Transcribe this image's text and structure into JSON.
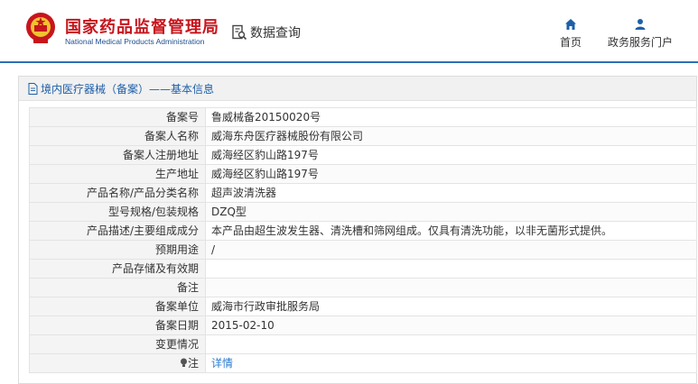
{
  "header": {
    "org_name_cn": "国家药品监督管理局",
    "org_name_en": "National Medical Products Administration",
    "query_label": "数据查询",
    "nav": [
      {
        "label": "首页",
        "icon": "home-icon"
      },
      {
        "label": "政务服务门户",
        "icon": "user-icon"
      }
    ]
  },
  "panel": {
    "title": "境内医疗器械（备案）——基本信息",
    "title_icon": "document-icon"
  },
  "rows": [
    {
      "key": "备案号",
      "value": "鲁威械备20150020号"
    },
    {
      "key": "备案人名称",
      "value": "威海东舟医疗器械股份有限公司"
    },
    {
      "key": "备案人注册地址",
      "value": "威海经区豹山路197号"
    },
    {
      "key": "生产地址",
      "value": "威海经区豹山路197号"
    },
    {
      "key": "产品名称/产品分类名称",
      "value": "超声波清洗器"
    },
    {
      "key": "型号规格/包装规格",
      "value": "DZQ型"
    },
    {
      "key": "产品描述/主要组成成分",
      "value": "本产品由超生波发生器、清洗槽和筛网组成。仅具有清洗功能，以非无菌形式提供。"
    },
    {
      "key": "预期用途",
      "value": "/"
    },
    {
      "key": "产品存储及有效期",
      "value": ""
    },
    {
      "key": "备注",
      "value": ""
    },
    {
      "key": "备案单位",
      "value": "威海市行政审批服务局"
    },
    {
      "key": "备案日期",
      "value": "2015-02-10"
    },
    {
      "key": "变更情况",
      "value": ""
    }
  ],
  "note_row": {
    "key": "注",
    "icon": "lightbulb-icon",
    "link_label": "详情"
  },
  "colors": {
    "brand_red": "#c7151d",
    "brand_blue": "#1e4f8f",
    "link_blue": "#2b7bd0",
    "header_border": "#2d6fb5"
  }
}
